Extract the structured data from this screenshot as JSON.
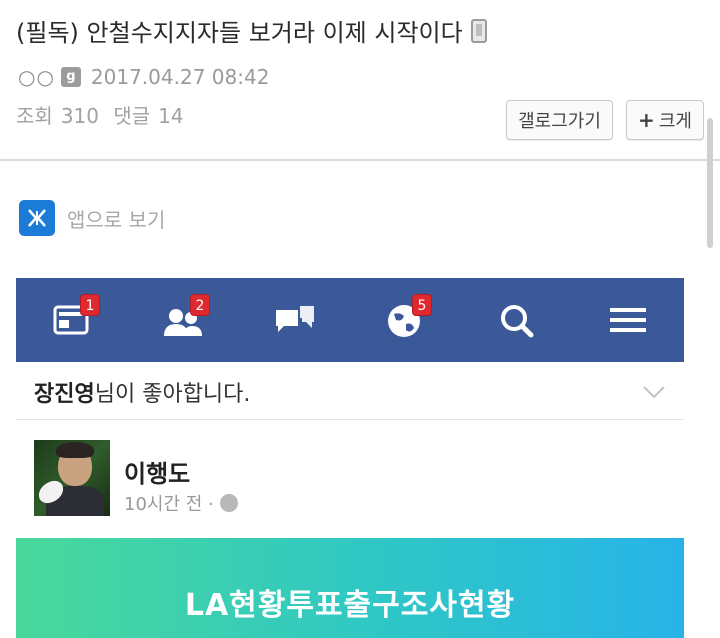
{
  "post": {
    "title": "(필독) 안철수지지자들 보거라 이제 시작이다",
    "author_masked": "○○",
    "date": "2017.04.27 08:42",
    "views_label": "조회",
    "views": "310",
    "comments_label": "댓글",
    "comments": "14"
  },
  "buttons": {
    "gallery": "갤로그가기",
    "enlarge_plus": "+",
    "enlarge": "크게"
  },
  "app_view": {
    "label": "앱으로 보기"
  },
  "facebook": {
    "colors": {
      "navbar": "#3b5998",
      "badge": "#e0282f"
    },
    "nav": [
      {
        "icon": "news-feed-icon",
        "badge": "1"
      },
      {
        "icon": "friend-requests-icon",
        "badge": "2"
      },
      {
        "icon": "messages-icon",
        "badge": ""
      },
      {
        "icon": "notifications-globe-icon",
        "badge": "5"
      },
      {
        "icon": "search-icon",
        "badge": ""
      },
      {
        "icon": "menu-icon",
        "badge": ""
      }
    ],
    "liked_by_name": "장진영",
    "liked_by_suffix": "님이 좋아합니다.",
    "post_author": "이행도",
    "post_time": "10시간 전 ·",
    "banner_text": "LA현황투표출구조사현황"
  }
}
